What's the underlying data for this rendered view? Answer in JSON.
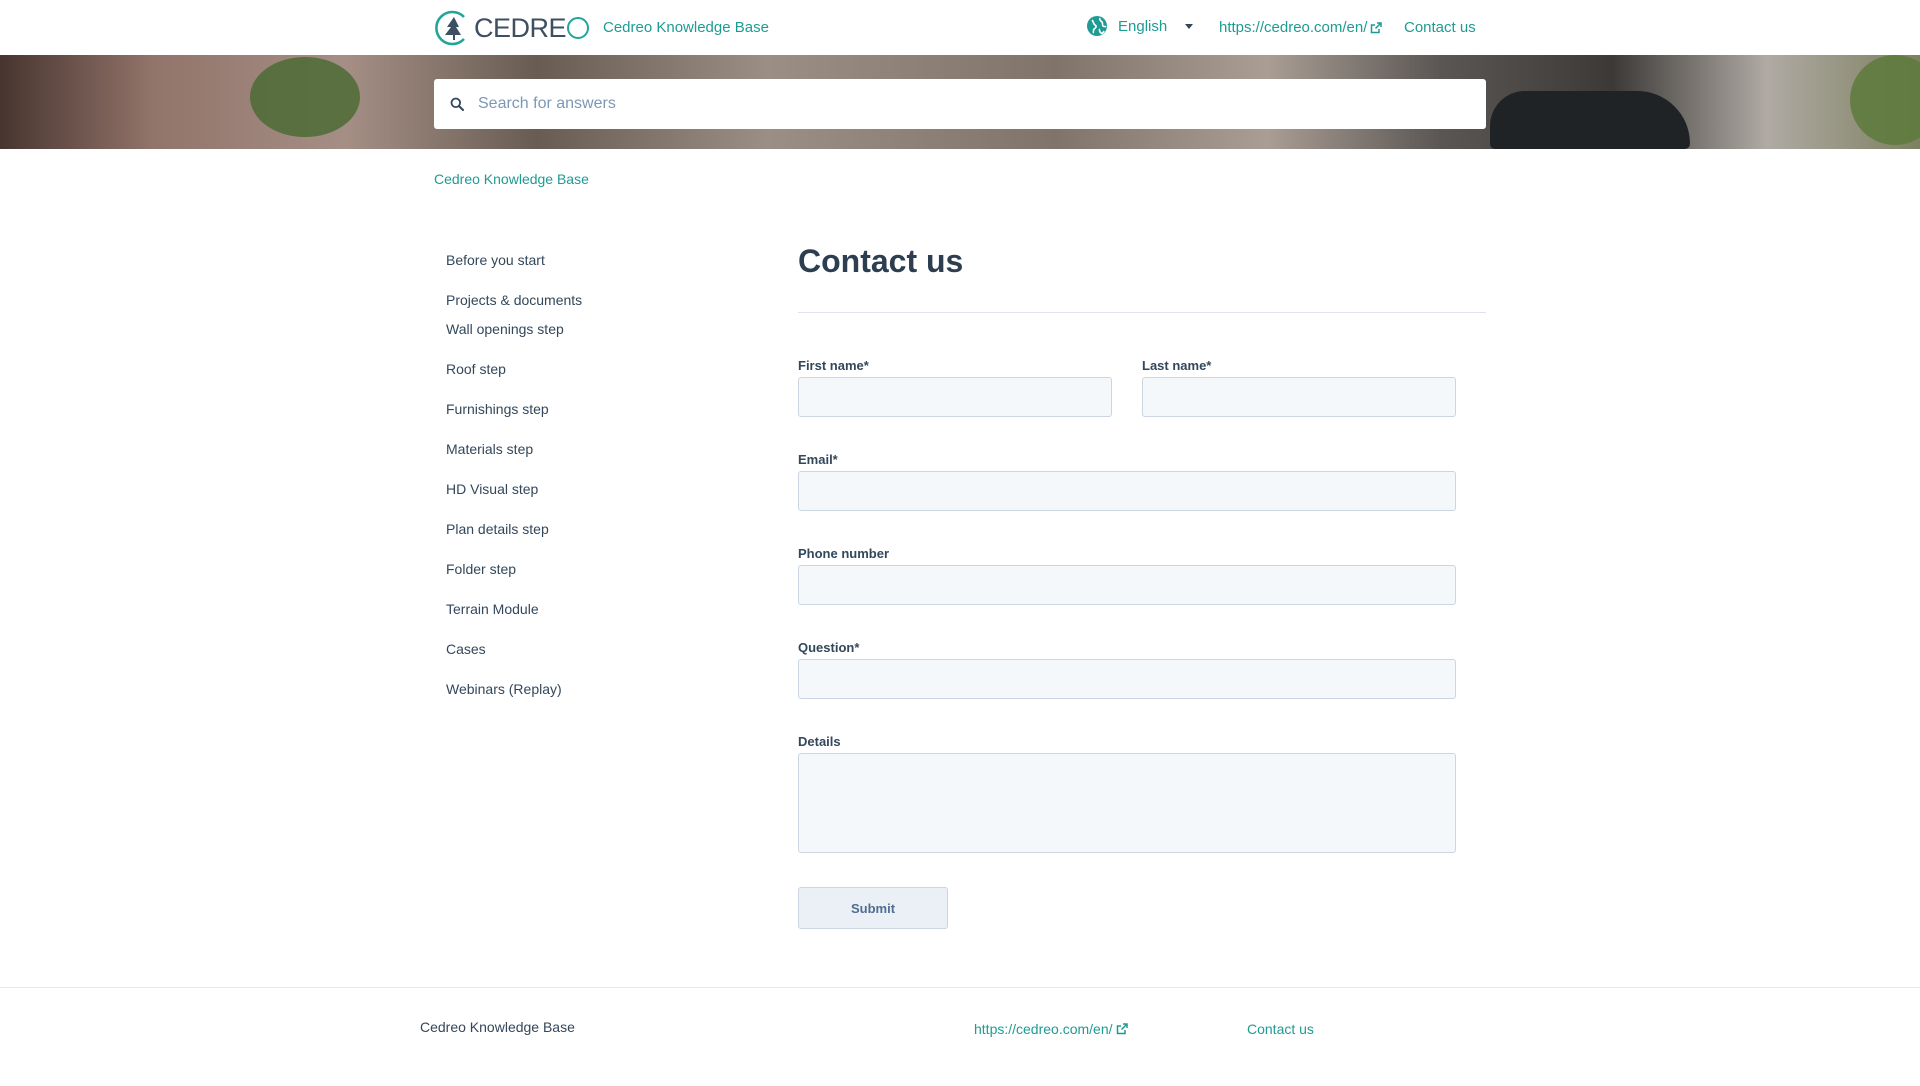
{
  "header": {
    "logo_text": "CEDRE",
    "kb_link": "Cedreo Knowledge Base",
    "language": "English",
    "external_link": "https://cedreo.com/en/",
    "contact_link": "Contact us"
  },
  "search": {
    "placeholder": "Search for answers"
  },
  "breadcrumb": "Cedreo Knowledge Base",
  "sidebar": {
    "items": [
      "Before you start",
      "Projects & documents",
      "Wall openings step",
      "Roof step",
      "Furnishings step",
      "Materials step",
      "HD Visual step",
      "Plan details step",
      "Folder step",
      "Terrain Module",
      "Cases",
      "Webinars (Replay)"
    ]
  },
  "form": {
    "title": "Contact us",
    "first_name_label": "First name*",
    "last_name_label": "Last name*",
    "email_label": "Email*",
    "phone_label": "Phone number",
    "question_label": "Question*",
    "details_label": "Details",
    "submit_label": "Submit"
  },
  "footer": {
    "kb_text": "Cedreo Knowledge Base",
    "external_link": "https://cedreo.com/en/",
    "contact_link": "Contact us"
  },
  "colors": {
    "accent": "#1e9b93",
    "logo_teal": "#21a59a",
    "text": "#33475b",
    "field_bg": "#f5f8fa",
    "field_border": "#cbd6e2"
  }
}
